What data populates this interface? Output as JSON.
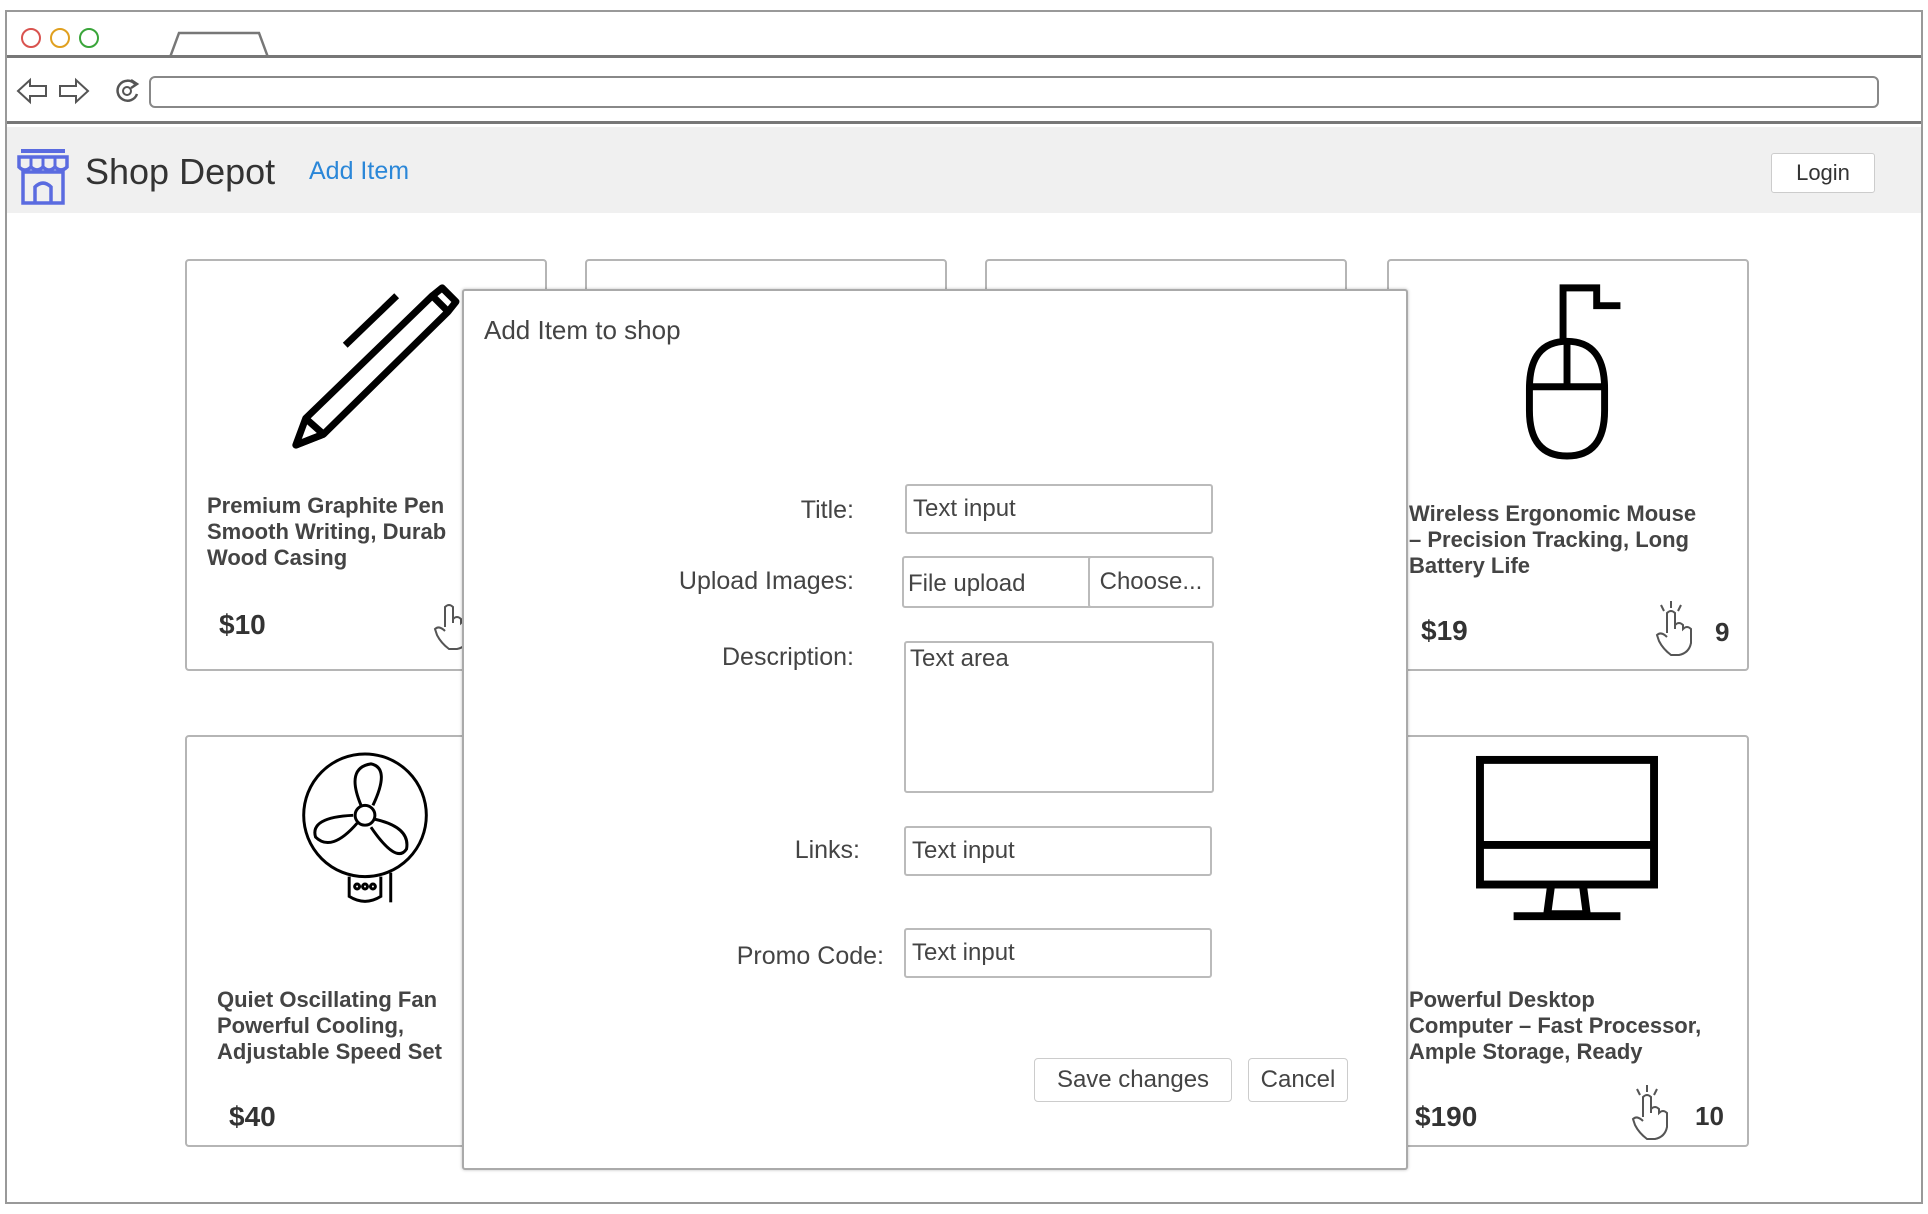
{
  "browser": {
    "url_value": ""
  },
  "header": {
    "brand_name": "Shop Depot",
    "nav_add_item": "Add Item",
    "login_label": "Login",
    "accent_color": "#2b87d8",
    "logo_color": "#5a6be0"
  },
  "products": [
    {
      "title": "Premium Graphite Pen\nSmooth Writing, Durab\nWood Casing",
      "price": "$10",
      "likes": "",
      "icon": "pen-icon"
    },
    {
      "title": "Wireless Ergonomic Mouse\n– Precision Tracking, Long\nBattery Life",
      "price": "$19",
      "likes": "9",
      "icon": "mouse-icon"
    },
    {
      "title": "Quiet Oscillating Fan\nPowerful Cooling,\nAdjustable Speed Set",
      "price": "$40",
      "likes": "",
      "icon": "fan-icon"
    },
    {
      "title": "Powerful Desktop\nComputer – Fast Processor,\nAmple Storage, Ready",
      "price": "$190",
      "likes": "10",
      "icon": "desktop-icon"
    }
  ],
  "modal": {
    "title": "Add Item to shop",
    "title_label": "Title:",
    "title_value": "Text input",
    "upload_label": "Upload Images:",
    "upload_value": "File upload",
    "choose_label": "Choose...",
    "description_label": "Description:",
    "description_value": "Text area",
    "links_label": "Links:",
    "links_value": "Text input",
    "promo_label": "Promo Code:",
    "promo_value": "Text input",
    "save_label": "Save changes",
    "cancel_label": "Cancel"
  }
}
